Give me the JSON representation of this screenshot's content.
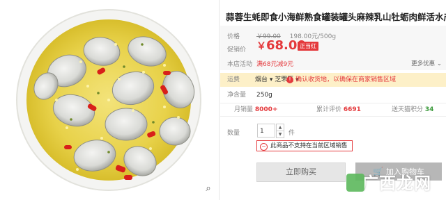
{
  "product": {
    "title": "蒜蓉生蚝即食小海鲜熟食罐装罐头麻辣乳山牡蛎肉鲜活水产大礼包"
  },
  "price": {
    "orig_label": "价格",
    "orig_price": "￥99.00",
    "unit_price": "198.00元/500g",
    "sale_label": "促销价",
    "currency": "￥",
    "sale_price": "68.00",
    "badge": "正当红",
    "promo_label": "本店活动",
    "promo_text": "满68元减9元",
    "more_label": "更多优惠",
    "more_icon": "chevron-down-icon"
  },
  "shipping": {
    "label": "运费",
    "location": "烟台 ▾ 芝罘区 ▾",
    "warning": "确认收货地，以确保在商家销售区域"
  },
  "spec": {
    "label": "净含量",
    "value": "250g"
  },
  "stats": {
    "monthly_label": "月销量",
    "monthly_value": "8000+",
    "reviews_label": "累计评价",
    "reviews_value": "6691",
    "points_label": "送天猫积分",
    "points_value": "34"
  },
  "quantity": {
    "label": "数量",
    "value": "1",
    "unit": "件",
    "up_icon": "caret-up-icon",
    "down_icon": "caret-down-icon",
    "notice": "此商品不支持在当前区域销售"
  },
  "actions": {
    "buy_now": "立即购买",
    "add_cart": "加入购物车"
  },
  "watermark": {
    "text": "广西龙网"
  },
  "gallery": {
    "zoom_icon": "magnifier-icon"
  },
  "colors": {
    "accent": "#e4393c",
    "shipping_bg": "#fdf0c8",
    "points_green": "#3b9a3b"
  }
}
